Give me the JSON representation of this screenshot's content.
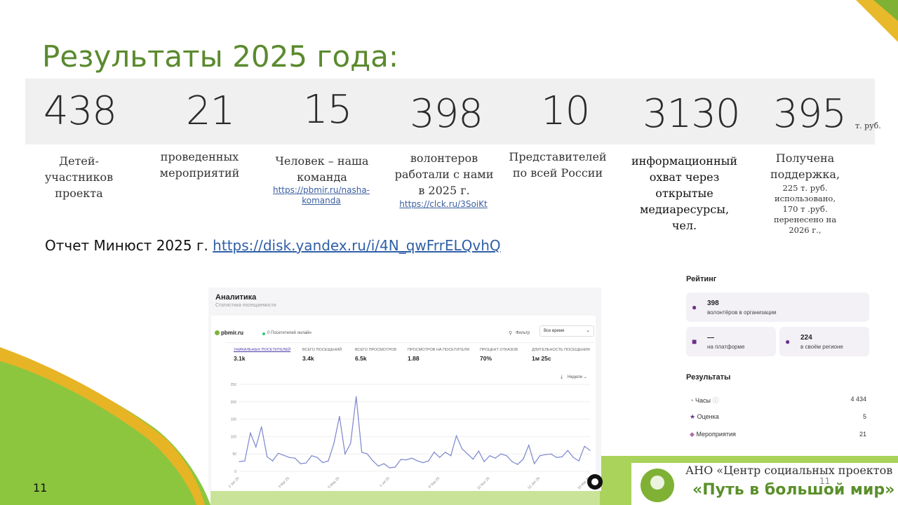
{
  "slide": {
    "title": "Результаты 2025 года:",
    "page_number_left": "11",
    "page_number_right": "11"
  },
  "stats": [
    {
      "value": "438",
      "caption": "Детей-\nучастников\nпроекта"
    },
    {
      "value": "21",
      "caption": "проведенных\nмероприятий"
    },
    {
      "value": "15",
      "caption": "Человек – наша\nкоманда",
      "link": "https://pbmir.ru/nasha-\nkomanda"
    },
    {
      "value": "398",
      "caption": "волонтеров\nработали с нами\nв 2025 г.",
      "link": "https://clck.ru/3SoiKt"
    },
    {
      "value": "10",
      "caption": "Представителей\nпо всей России"
    },
    {
      "value": "3130",
      "caption": "информационный\nохват через\nоткрытые\nмедиаресурсы,\nчел."
    },
    {
      "value": "395",
      "unit": "т. руб.",
      "caption": "Получена\nподдержка,",
      "note": "225 т. руб.\nиспользовано,\n170 т .руб.\nперенесено на\n2026 г.,"
    }
  ],
  "report": {
    "label": "Отчет Минюст 2025 г.",
    "link": "https://disk.yandex.ru/i/4N_qwFrrELQvhQ"
  },
  "analytics": {
    "title": "Аналитика",
    "subtitle": "Статистика посещаемости",
    "site": "pbmir.ru",
    "online": "0 Посетителей онлайн",
    "filter_label": "Фильтр",
    "period": "Все время",
    "metrics": [
      {
        "label": "УНИКАЛЬНЫХ ПОСЕТИТЕЛЕЙ",
        "value": "3.1k"
      },
      {
        "label": "ВСЕГО ПОСЕЩЕНИЙ",
        "value": "3.4k"
      },
      {
        "label": "ВСЕГО ПРОСМОТРОВ",
        "value": "6.5k"
      },
      {
        "label": "ПРОСМОТРОВ НА ПОСЕТИТЕЛЯ",
        "value": "1.88"
      },
      {
        "label": "ПРОЦЕНТ ОТКАЗОВ",
        "value": "70%"
      },
      {
        "label": "ДЛИТЕЛЬНОСТЬ ПОСЕЩЕНИЯ",
        "value": "1м 25с"
      }
    ],
    "granularity": "Недели"
  },
  "chart_data": {
    "type": "line",
    "ylim": [
      0,
      250
    ],
    "yticks": [
      "0",
      "50",
      "100",
      "150",
      "200",
      "250"
    ],
    "xticks": [
      "2 Jan 25",
      "3 Mar 25",
      "5 May 25",
      "1 Jul 25",
      "8 Sep 25",
      "10 Nov 25",
      "12 Jan 26",
      "16 Mar 26"
    ],
    "color": "#7b86cc",
    "values": [
      28,
      30,
      110,
      70,
      128,
      42,
      30,
      52,
      46,
      40,
      38,
      22,
      24,
      45,
      40,
      25,
      30,
      80,
      158,
      50,
      80,
      215,
      55,
      50,
      30,
      15,
      22,
      10,
      12,
      34,
      33,
      38,
      30,
      25,
      30,
      55,
      40,
      55,
      45,
      102,
      65,
      50,
      35,
      58,
      28,
      45,
      38,
      50,
      45,
      28,
      20,
      35,
      75,
      22,
      45,
      48,
      50,
      40,
      42,
      60,
      40,
      30,
      72,
      60
    ]
  },
  "rating": {
    "title": "Рейтинг",
    "volunteers_value": "398",
    "volunteers_label": "волонтёров в организации",
    "platform_value": "—",
    "platform_label": "на платформе",
    "region_value": "224",
    "region_label": "в своём регионе",
    "results_title": "Результаты",
    "rows": [
      {
        "label": "Часы",
        "value": "4 434"
      },
      {
        "label": "Оценка",
        "value": "5"
      },
      {
        "label": "Мероприятия",
        "value": "21"
      }
    ]
  },
  "organization": {
    "line1": "АНО «Центр социальных проектов",
    "line2": "«Путь в большой мир»"
  },
  "colors": {
    "title_green": "#5a8a2e",
    "accent_purple": "#6d2f8a",
    "link_blue": "#2f5fa8"
  }
}
